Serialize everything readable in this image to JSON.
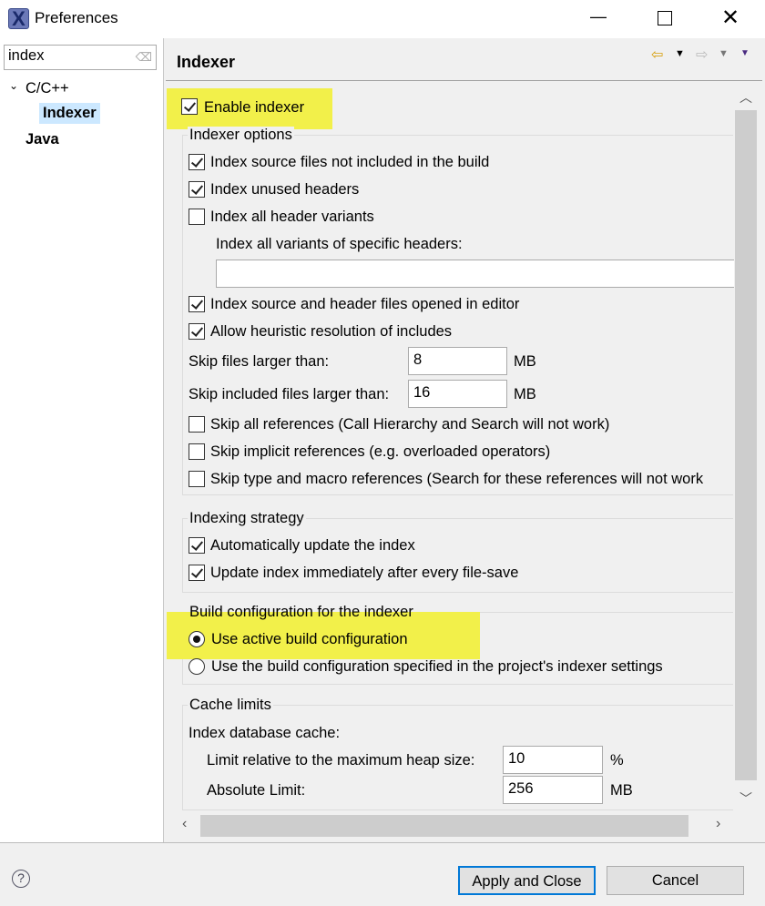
{
  "window": {
    "title": "Preferences",
    "icon": "eclipse-x-icon"
  },
  "filter": {
    "value": "index",
    "clear_icon": "eraser-icon"
  },
  "tree": [
    {
      "label": "C/C++",
      "expanded": true
    },
    {
      "label": "Indexer",
      "selected": true
    },
    {
      "label": "Java"
    }
  ],
  "page": {
    "title": "Indexer"
  },
  "enable_indexer": {
    "label": "Enable indexer",
    "checked": true
  },
  "indexer_options": {
    "title": "Indexer options",
    "items": [
      {
        "label": "Index source files not included in the build",
        "checked": true
      },
      {
        "label": "Index unused headers",
        "checked": true
      },
      {
        "label": "Index all header variants",
        "checked": false
      }
    ],
    "variants_label": "Index all variants of specific headers:",
    "variants_value": "",
    "items2": [
      {
        "label": "Index source and header files opened in editor",
        "checked": true
      },
      {
        "label": "Allow heuristic resolution of includes",
        "checked": true
      }
    ],
    "skip_files_label": "Skip files larger than:",
    "skip_files_value": "8",
    "skip_files_unit": "MB",
    "skip_included_label": "Skip included files larger than:",
    "skip_included_value": "16",
    "skip_included_unit": "MB",
    "items3": [
      {
        "label": "Skip all references (Call Hierarchy and Search will not work)",
        "checked": false
      },
      {
        "label": "Skip implicit references (e.g. overloaded operators)",
        "checked": false
      },
      {
        "label": "Skip type and macro references (Search for these references will not work",
        "checked": false
      }
    ]
  },
  "strategy": {
    "title": "Indexing strategy",
    "items": [
      {
        "label": "Automatically update the index",
        "checked": true
      },
      {
        "label": "Update index immediately after every file-save",
        "checked": true
      }
    ]
  },
  "build_config": {
    "title": "Build configuration for the indexer",
    "options": [
      {
        "label": "Use active build configuration",
        "selected": true
      },
      {
        "label": "Use the build configuration specified in the project's indexer settings",
        "selected": false
      }
    ]
  },
  "cache": {
    "title": "Cache limits",
    "db_label": "Index database cache:",
    "relative_label": "Limit relative to the maximum heap size:",
    "relative_value": "10",
    "relative_unit": "%",
    "absolute_label": "Absolute Limit:",
    "absolute_value": "256",
    "absolute_unit": "MB"
  },
  "buttons": {
    "apply_close": "Apply and Close",
    "cancel": "Cancel"
  },
  "colors": {
    "highlight": "#f2f04a",
    "selection": "#cce8ff",
    "default_button_border": "#0078d7"
  }
}
